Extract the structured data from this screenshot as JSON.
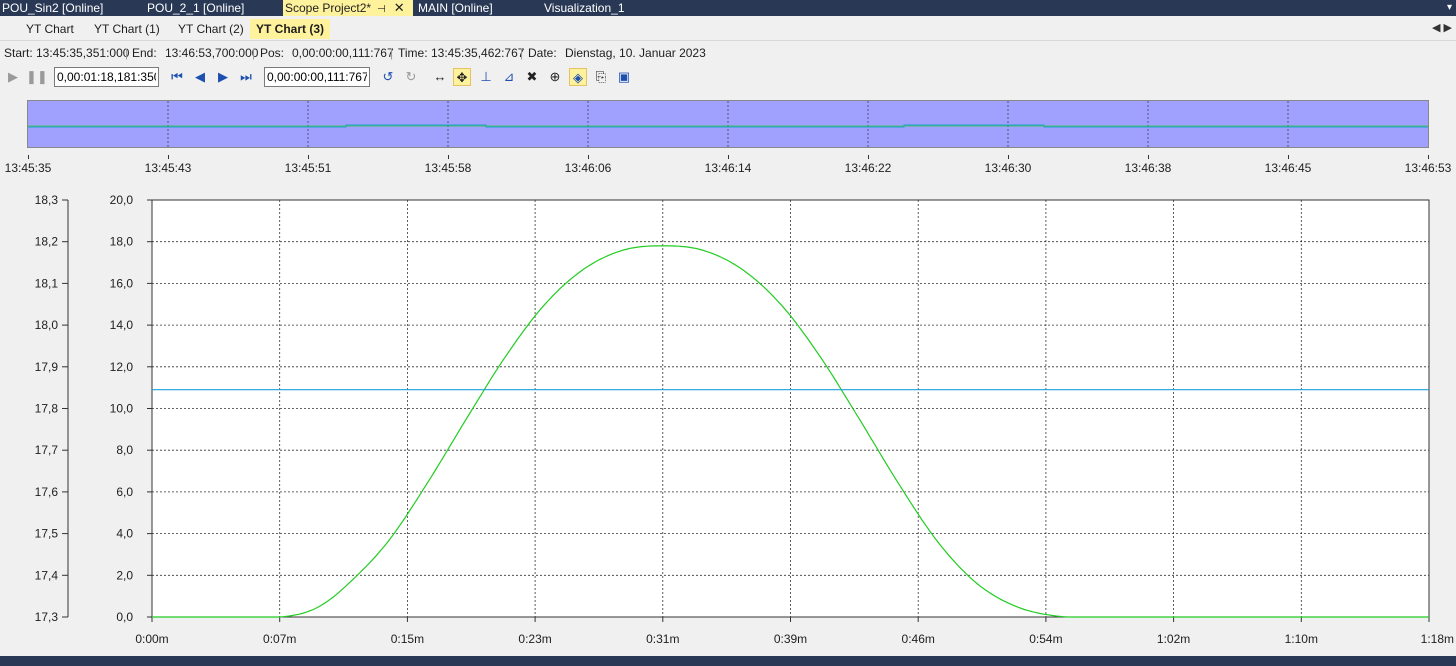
{
  "doc_tabs": [
    {
      "label": "POU_Sin2 [Online]",
      "active": false
    },
    {
      "label": "POU_2_1 [Online]",
      "active": false
    },
    {
      "label": "Scope Project2*",
      "active": true
    },
    {
      "label": "MAIN [Online]",
      "active": false
    },
    {
      "label": "Visualization_1",
      "active": false
    }
  ],
  "doc_tab_icons": {
    "pin": "pin-icon",
    "close": "close-icon",
    "menu": "chevron-down-icon"
  },
  "chart_tabs": [
    {
      "label": "YT Chart",
      "active": false
    },
    {
      "label": "YT Chart (1)",
      "active": false
    },
    {
      "label": "YT Chart (2)",
      "active": false
    },
    {
      "label": "YT Chart (3)",
      "active": true
    }
  ],
  "info": {
    "start_label": "Start:",
    "start_value": "13:45:35,351:000",
    "end_label": "End:",
    "end_value": "13:46:53,700:000",
    "pos_label": "Pos:",
    "pos_value": "0,00:00:00,111:767",
    "time_label": "Time:",
    "time_value": "13:45:35,462:767",
    "date_label": "Date:",
    "date_value": "Dienstag, 10. Januar 2023"
  },
  "toolbar": {
    "range_value": "0,00:01:18,181:350",
    "position_value": "0,00:00:00,111:767",
    "buttons": [
      "play-icon",
      "pause-icon",
      "first-frame-icon",
      "previous-icon",
      "next-icon",
      "last-frame-icon",
      "undo-icon",
      "redo-icon",
      "pan-horizontal-icon",
      "pan-all-icon",
      "cursor-icon",
      "cursor-delta-icon",
      "delete-cursor-icon",
      "zoom-max-icon",
      "overview-toggle-icon",
      "export-icon",
      "screenshot-icon"
    ]
  },
  "overview_axis": {
    "labels": [
      "13:45:35",
      "13:45:43",
      "13:45:51",
      "13:45:58",
      "13:46:06",
      "13:46:14",
      "13:46:22",
      "13:46:30",
      "13:46:38",
      "13:46:45",
      "13:46:53"
    ]
  },
  "colors": {
    "overview_fill": "#a0a0ff",
    "green_series": "#22cc22",
    "cyan_series": "#1e9fd8",
    "active_tab": "#fff29d",
    "tab_bar": "#293955"
  },
  "chart_data": {
    "type": "line",
    "xlabel": "",
    "ylabel": "",
    "x_ticks": [
      "0:00m",
      "0:07m",
      "0:15m",
      "0:23m",
      "0:31m",
      "0:39m",
      "0:46m",
      "0:54m",
      "1:02m",
      "1:10m",
      "1:18m"
    ],
    "y_left_ticks": [
      "18,3",
      "18,2",
      "18,1",
      "18,0",
      "17,9",
      "17,8",
      "17,7",
      "17,6",
      "17,5",
      "17,4",
      "17,3"
    ],
    "y_right_ticks": [
      "20,0",
      "18,0",
      "16,0",
      "14,0",
      "12,0",
      "10,0",
      "8,0",
      "6,0",
      "4,0",
      "2,0",
      "0,0"
    ],
    "xlim_minutes": [
      0,
      1.3
    ],
    "ylim": [
      0,
      20
    ],
    "ylim_left": [
      17.3,
      18.3
    ],
    "grid": true,
    "series": [
      {
        "color": "#22cc22",
        "axis": "right",
        "x_minutes": [
          0,
          0.1,
          0.14,
          0.17,
          0.2,
          0.24,
          0.28,
          0.32,
          0.36,
          0.4,
          0.44,
          0.48,
          0.52,
          0.56,
          0.6,
          0.64,
          0.68,
          0.72,
          0.76,
          0.8,
          0.84,
          0.88,
          0.92,
          0.96,
          1.0,
          1.04,
          1.06,
          1.1,
          1.2,
          1.3
        ],
        "values": [
          0,
          0,
          0.05,
          0.5,
          1.6,
          3.6,
          6.4,
          9.5,
          12.5,
          15.0,
          16.7,
          17.6,
          17.8,
          17.6,
          16.7,
          15.0,
          12.5,
          9.5,
          6.4,
          3.6,
          1.6,
          0.5,
          0.05,
          0,
          0,
          0,
          0,
          0,
          0,
          0
        ]
      },
      {
        "color": "#1e9fd8",
        "axis": "right",
        "x_minutes": [
          0,
          1.3
        ],
        "values": [
          10.9,
          10.9
        ]
      }
    ]
  }
}
